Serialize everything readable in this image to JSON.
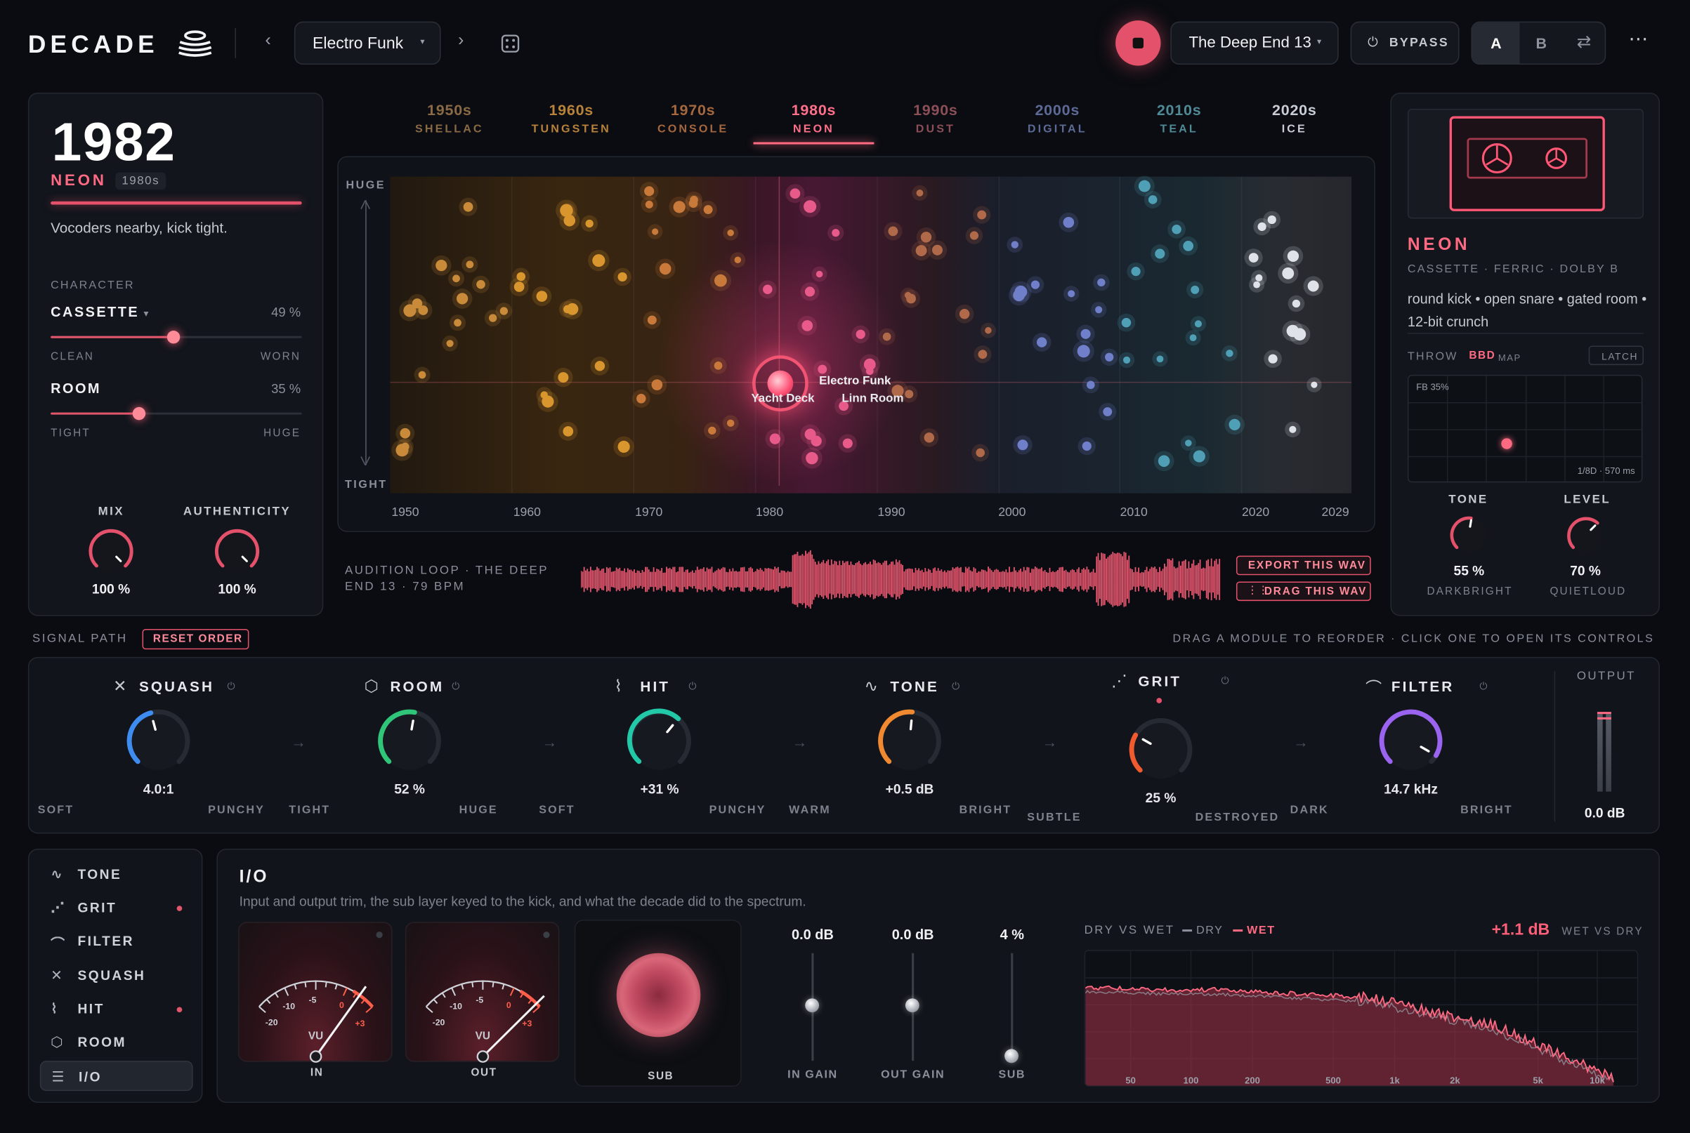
{
  "header": {
    "logo": "DECADE",
    "preset": "Electro Funk",
    "preset_b": "The Deep End 13",
    "bypass_label": "BYPASS",
    "ab": [
      "A",
      "B"
    ]
  },
  "left": {
    "year": "1982",
    "era_name": "NEON",
    "era_tag": "1980s",
    "desc": "Vocoders nearby, kick tight.",
    "character_label": "CHARACTER",
    "character_value": "CASSETTE",
    "character_pct": "49 %",
    "clean": "CLEAN",
    "worn": "WORN",
    "room_label": "ROOM",
    "room_pct": "35 %",
    "tight": "TIGHT",
    "huge": "HUGE",
    "mix_label": "MIX",
    "mix_value": "100 %",
    "auth_label": "AUTHENTICITY",
    "auth_value": "100 %",
    "character_level": 0.49,
    "room_level": 0.35
  },
  "eras": [
    {
      "year": "1950s",
      "name": "SHELLAC",
      "color": "#8a6a45"
    },
    {
      "year": "1960s",
      "name": "TUNGSTEN",
      "color": "#b8823a"
    },
    {
      "year": "1970s",
      "name": "CONSOLE",
      "color": "#a5673e"
    },
    {
      "year": "1980s",
      "name": "NEON",
      "color": "#ff6f8a"
    },
    {
      "year": "1990s",
      "name": "DUST",
      "color": "#8c4f58"
    },
    {
      "year": "2000s",
      "name": "DIGITAL",
      "color": "#5d6a96"
    },
    {
      "year": "2010s",
      "name": "TEAL",
      "color": "#4f8a96"
    },
    {
      "year": "2020s",
      "name": "ICE",
      "color": "#c9cdd6"
    }
  ],
  "map": {
    "y_top": "HUGE",
    "y_bottom": "TIGHT",
    "x_ticks": [
      "1950",
      "1960",
      "1970",
      "1980",
      "1990",
      "2000",
      "2010",
      "2020",
      "2029"
    ],
    "labels": [
      "Electro Funk",
      "Yacht Deck",
      "Linn Room"
    ]
  },
  "audition": {
    "label": "AUDITION LOOP · THE DEEP END 13 · 79 BPM",
    "export": "EXPORT THIS WAV",
    "drag": "DRAG THIS WAV"
  },
  "right": {
    "name": "NEON",
    "sub": "CASSETTE · FERRIC · DOLBY B",
    "desc": "round kick • open snare • gated room • 12-bit crunch",
    "throw": "THROW",
    "bbd": "BBD",
    "map": "MAP",
    "latch": "LATCH",
    "fb": "FB 35%",
    "delay": "1/8D · 570 ms",
    "tone_label": "TONE",
    "tone_value": "55 %",
    "tone_range": "DARKBRIGHT",
    "level_label": "LEVEL",
    "level_value": "70 %",
    "level_range": "QUIETLOUD"
  },
  "signal": {
    "label": "SIGNAL PATH",
    "reset": "RESET ORDER",
    "hint": "DRAG A MODULE TO REORDER · CLICK ONE TO OPEN ITS CONTROLS",
    "modules": [
      {
        "name": "SQUASH",
        "value": "4.0:1",
        "lo": "SOFT",
        "hi": "PUNCHY",
        "color": "#3f8cf0"
      },
      {
        "name": "ROOM",
        "value": "52 %",
        "lo": "TIGHT",
        "hi": "HUGE",
        "color": "#2fc67a"
      },
      {
        "name": "HIT",
        "value": "+31 %",
        "lo": "SOFT",
        "hi": "PUNCHY",
        "color": "#22c9a9"
      },
      {
        "name": "TONE",
        "value": "+0.5 dB",
        "lo": "WARM",
        "hi": "BRIGHT",
        "color": "#f0892f"
      },
      {
        "name": "GRIT",
        "value": "25 %",
        "lo": "SUBTLE",
        "hi": "DESTROYED",
        "color": "#f05a2f"
      },
      {
        "name": "FILTER",
        "value": "14.7 kHz",
        "lo": "DARK",
        "hi": "BRIGHT",
        "color": "#9a64f0"
      }
    ],
    "output_label": "OUTPUT",
    "output_value": "0.0 dB"
  },
  "sidebar": [
    {
      "icon": "∿",
      "label": "TONE",
      "dot": false
    },
    {
      "icon": "⋰",
      "label": "GRIT",
      "dot": true
    },
    {
      "icon": "⌒",
      "label": "FILTER",
      "dot": false
    },
    {
      "icon": "✕",
      "label": "SQUASH",
      "dot": false
    },
    {
      "icon": "⌇",
      "label": "HIT",
      "dot": true
    },
    {
      "icon": "⬡",
      "label": "ROOM",
      "dot": false
    },
    {
      "icon": "☰",
      "label": "I/O",
      "dot": false
    }
  ],
  "io": {
    "title": "I/O",
    "desc": "Input and output trim, the sub layer keyed to the kick, and what the decade did to the spectrum.",
    "in_label": "IN",
    "out_label": "OUT",
    "vu": "VU",
    "scale": [
      "-20",
      "-10",
      "-5",
      "0",
      "+3"
    ],
    "sub_label": "SUB",
    "in_gain": "0.0 dB",
    "in_gain_label": "IN GAIN",
    "out_gain": "0.0 dB",
    "out_gain_label": "OUT GAIN",
    "sub": "4 %",
    "sub_fader_label": "SUB",
    "spectrum_title": "DRY VS WET",
    "dry": "DRY",
    "wet": "WET",
    "delta": "+1.1 dB",
    "delta_label": "WET VS DRY",
    "freqs": [
      "50",
      "100",
      "200",
      "500",
      "1k",
      "2k",
      "5k",
      "10k"
    ]
  }
}
